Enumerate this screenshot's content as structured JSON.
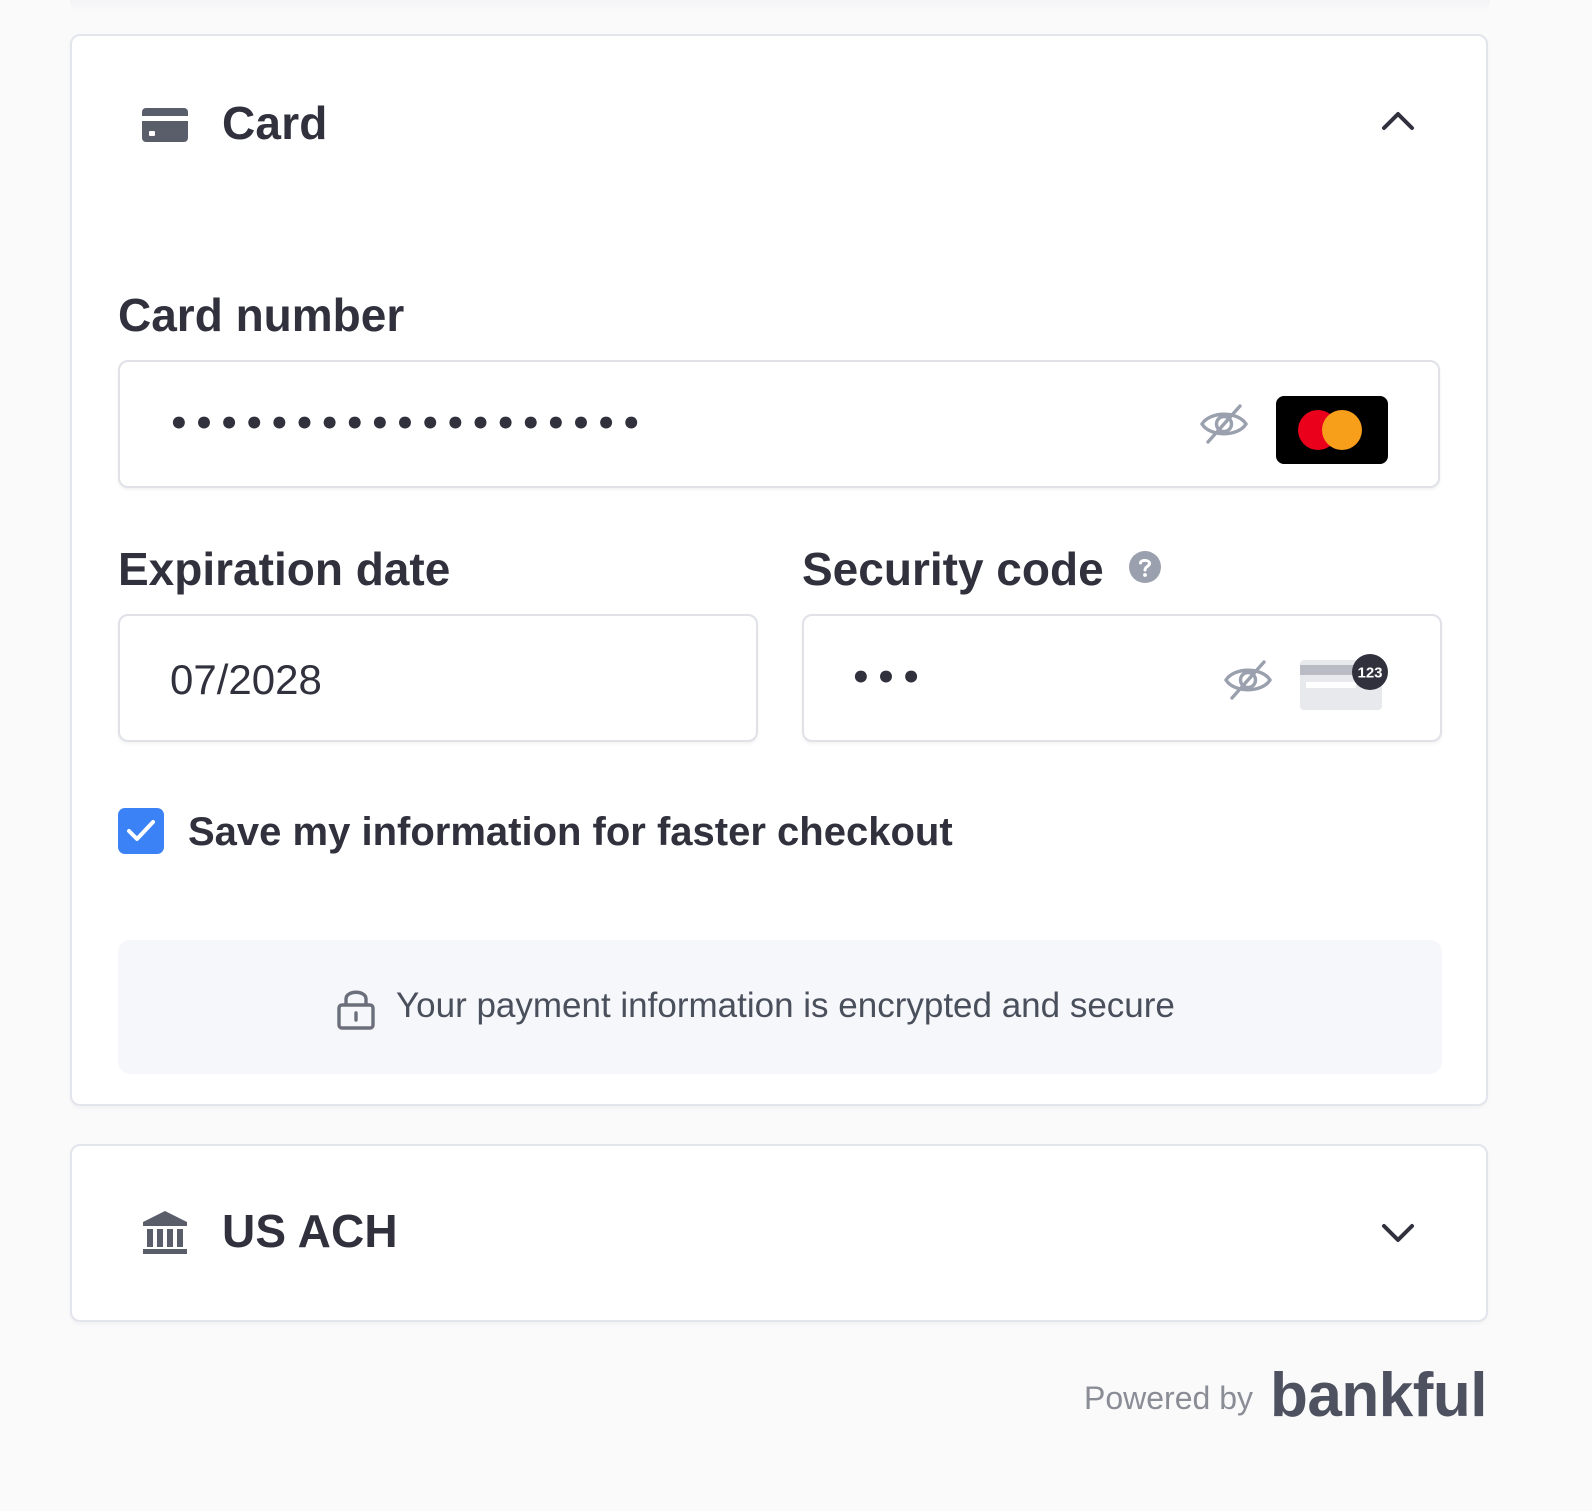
{
  "card_section": {
    "title": "Card",
    "icon": "credit-card-icon",
    "expanded": true,
    "chevron_icon": "chevron-up-icon"
  },
  "card_number": {
    "label": "Card number",
    "value_masked": "•••••••••••••••••••",
    "visibility_icon": "eye-off-icon",
    "brand_icon": "mastercard-logo"
  },
  "expiration": {
    "label": "Expiration date",
    "value": "07/2028"
  },
  "security_code": {
    "label": "Security code",
    "help_icon": "question-circle-icon",
    "value_masked": "•••",
    "visibility_icon": "eye-off-icon",
    "card_hint_text": "123"
  },
  "save_info": {
    "checked": true,
    "label": "Save my information for faster checkout"
  },
  "secure_notice": {
    "icon": "lock-icon",
    "text": "Your payment information is encrypted and secure"
  },
  "ach_section": {
    "title": "US ACH",
    "icon": "bank-icon",
    "expanded": false,
    "chevron_icon": "chevron-down-icon"
  },
  "footer": {
    "powered_by": "Powered by",
    "brand": "bankful"
  },
  "colors": {
    "accent": "#3b82f6",
    "text": "#30313d",
    "muted": "#8a8d96",
    "border": "#e3e5ec",
    "page_bg": "#fafafb"
  }
}
